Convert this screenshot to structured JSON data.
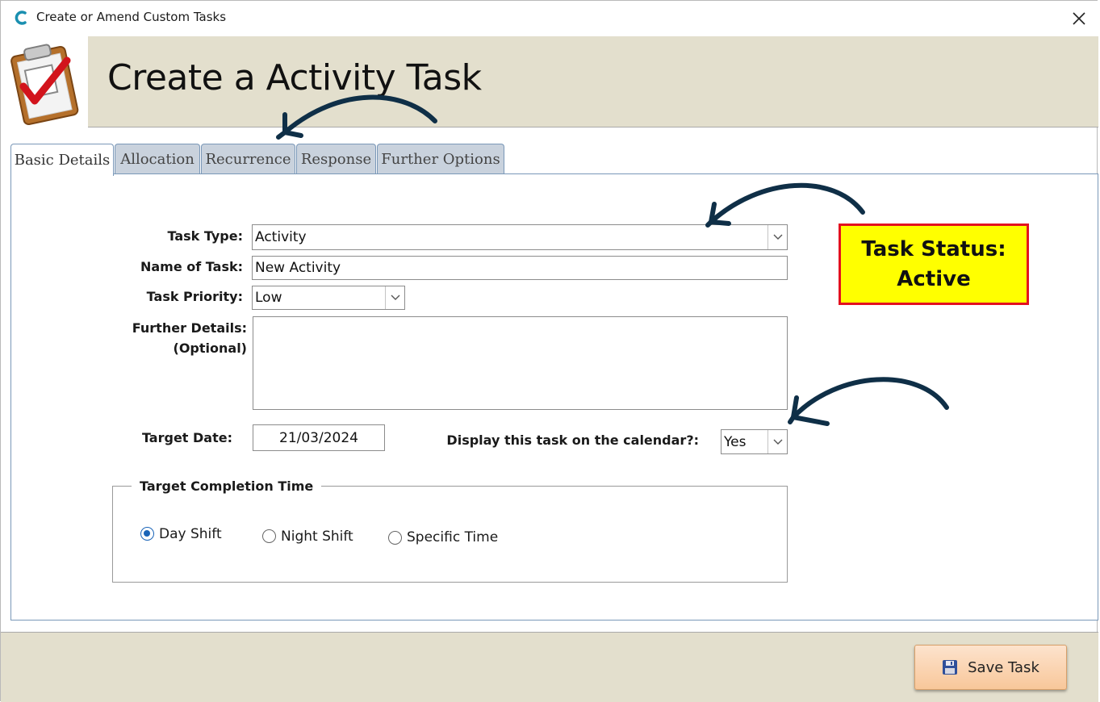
{
  "window": {
    "title": "Create or Amend Custom Tasks",
    "close_glyph": "✕"
  },
  "header": {
    "title": "Create a Activity Task",
    "logo_icon": "clipboard-check-icon"
  },
  "tabs": [
    {
      "label": "Basic Details",
      "active": true
    },
    {
      "label": "Allocation",
      "active": false
    },
    {
      "label": "Recurrence",
      "active": false
    },
    {
      "label": "Response",
      "active": false
    },
    {
      "label": "Further Options",
      "active": false
    }
  ],
  "form": {
    "task_type": {
      "label": "Task Type:",
      "value": "Activity"
    },
    "name_of_task": {
      "label": "Name of Task:",
      "value": "New Activity"
    },
    "task_priority": {
      "label": "Task Priority:",
      "value": "Low"
    },
    "further_details": {
      "label_line1": "Further Details:",
      "label_line2": "(Optional)",
      "value": ""
    },
    "target_date": {
      "label": "Target Date:",
      "value": "21/03/2024"
    },
    "display_on_calendar": {
      "label": "Display this task on the calendar?:",
      "value": "Yes"
    }
  },
  "completion_time": {
    "legend": "Target Completion Time",
    "options": [
      {
        "label": "Day Shift",
        "checked": true
      },
      {
        "label": "Night Shift",
        "checked": false
      },
      {
        "label": "Specific Time",
        "checked": false
      }
    ]
  },
  "status": {
    "line1": "Task Status:",
    "line2": "Active",
    "background": "#ffff00",
    "border": "#e3111f"
  },
  "footer": {
    "save_label": "Save Task",
    "save_icon": "floppy-disk-icon"
  },
  "colors": {
    "header_band": "#e3dfcd",
    "tab_border": "#7a98b8",
    "annotation_arrow": "#0f2f47"
  }
}
